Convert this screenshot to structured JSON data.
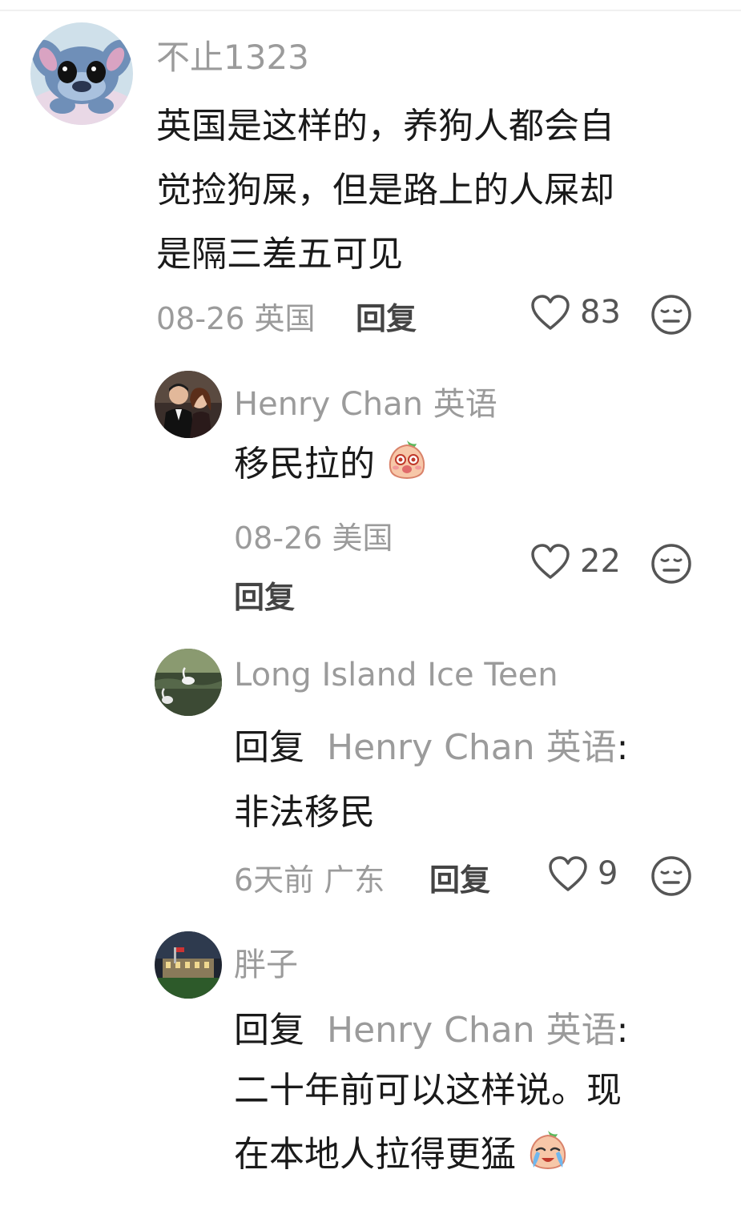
{
  "comments": [
    {
      "username": "不止1323",
      "text_lines": [
        "英国是这样的，养狗人都会自",
        "觉捡狗屎，但是路上的人屎却",
        "是隔三差五可见"
      ],
      "date": "08-26",
      "location": "英国",
      "reply_label": "回复",
      "likes": "83"
    }
  ],
  "replies": [
    {
      "username": "Henry Chan 英语",
      "text": "移民拉的",
      "emoji": "peach-shy-emoji",
      "date": "08-26",
      "location": "美国",
      "reply_label": "回复",
      "likes": "22"
    },
    {
      "username": "Long Island Ice Teen",
      "reply_prefix": "回复",
      "reply_target": "Henry Chan 英语",
      "reply_colon": ":",
      "text": "非法移民",
      "date": "6天前",
      "location": "广东",
      "reply_label": "回复",
      "likes": "9"
    },
    {
      "username": "胖子",
      "reply_prefix": "回复",
      "reply_target": "Henry Chan 英语",
      "reply_colon": ":",
      "text_lines": [
        "二十年前可以这样说。现",
        "在本地人拉得更猛"
      ],
      "emoji": "peach-crying-emoji"
    }
  ],
  "icons": {
    "like": "heart-outline-icon",
    "react": "neutral-face-icon"
  },
  "colors": {
    "username": "#9b9b9b",
    "text": "#1a1a1a",
    "meta": "#9b9b9b"
  }
}
